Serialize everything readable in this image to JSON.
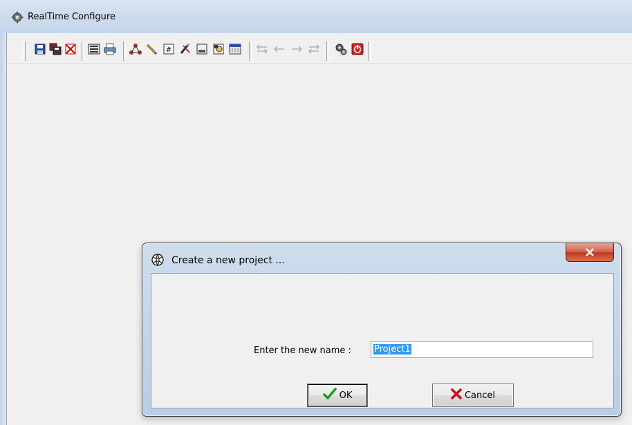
{
  "window": {
    "title": "RealTime Configure",
    "icon": "gear-network-icon"
  },
  "toolbar": {
    "groups": [
      [
        "save-icon",
        "save-as-icon",
        "close-project-icon"
      ],
      [
        "properties-icon",
        "print-icon"
      ],
      [
        "network-icon",
        "pencil-icon",
        "numeric-tag-icon",
        "tools-icon",
        "form-icon",
        "document-chart-icon",
        "calendar-icon"
      ],
      [
        "move-first-icon",
        "move-prev-icon",
        "move-next-icon",
        "move-last-icon"
      ],
      [
        "settings-run-icon",
        "power-icon"
      ]
    ]
  },
  "dialog": {
    "title": "Create a new project ...",
    "icon": "project-globe-icon",
    "close_label": "x",
    "prompt_label": "Enter the new name :",
    "input_value": "Project1",
    "ok_label": "OK",
    "cancel_label": "Cancel"
  },
  "colors": {
    "selection": "#3399ff",
    "close_button": "#c1371c",
    "ok_check": "#1e9b1e",
    "cancel_x": "#c8101a",
    "title_gradient": "#cfdcec"
  }
}
